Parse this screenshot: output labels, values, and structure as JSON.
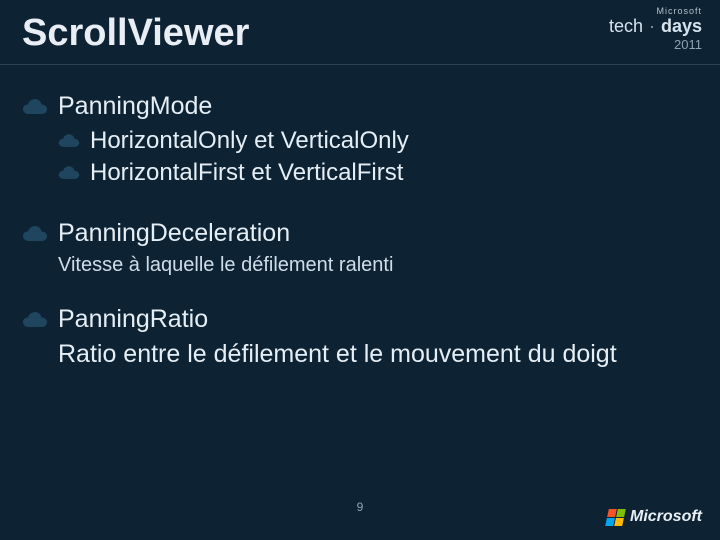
{
  "title": "ScrollViewer",
  "branding": {
    "ms_top": "Microsoft",
    "tech": "tech",
    "days": "days",
    "year": "2011"
  },
  "content": {
    "panning_mode": {
      "heading": "PanningMode",
      "sub1": "HorizontalOnly et VerticalOnly",
      "sub2": "HorizontalFirst et VerticalFirst"
    },
    "panning_deceleration": {
      "heading": "PanningDeceleration",
      "desc": "Vitesse à laquelle le défilement ralenti"
    },
    "panning_ratio": {
      "heading": "PanningRatio",
      "desc": "Ratio entre le défilement  et le mouvement du doigt"
    }
  },
  "page_number": "9",
  "footer": {
    "logo_text": "Microsoft"
  }
}
